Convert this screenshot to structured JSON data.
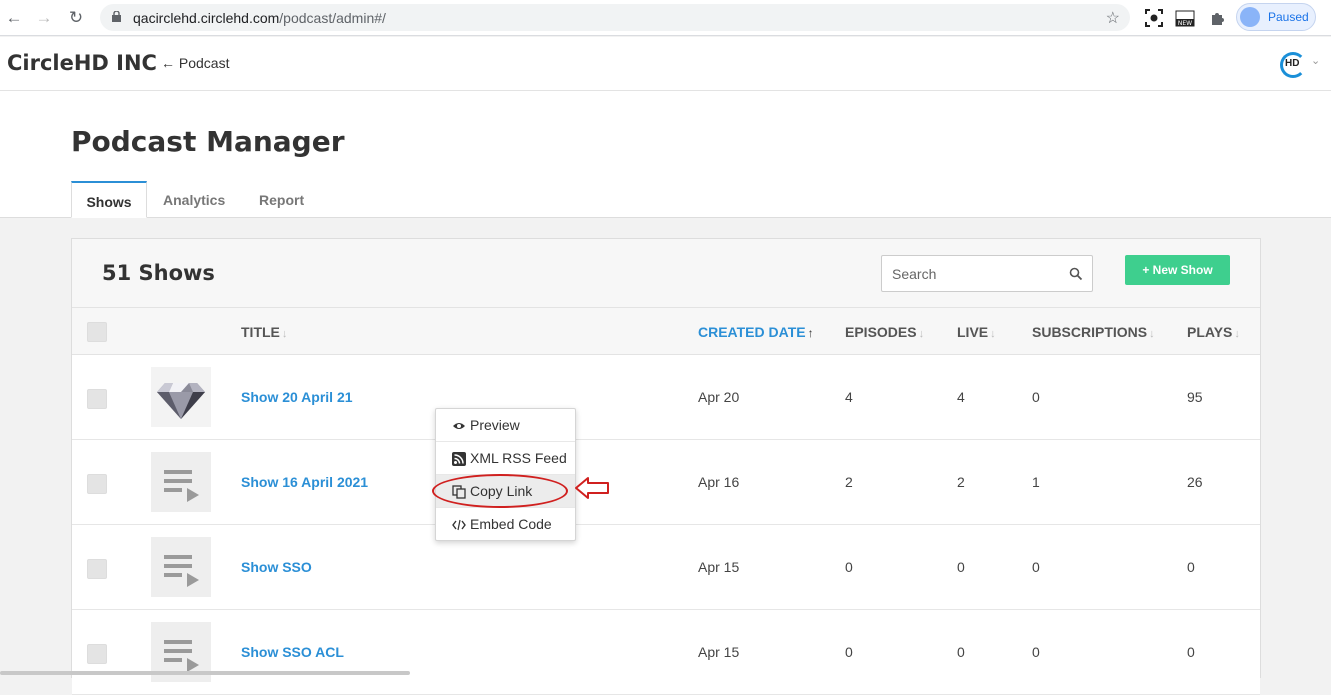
{
  "browser": {
    "url_host": "qacirclehd.circlehd.com",
    "url_path": "/podcast/admin#/",
    "profile_label": "Paused"
  },
  "app": {
    "brand": "CircleHD INC",
    "back_label": "Podcast",
    "logo_text": "HD"
  },
  "page": {
    "title": "Podcast Manager",
    "tabs": [
      {
        "label": "Shows",
        "active": true
      },
      {
        "label": "Analytics",
        "active": false
      },
      {
        "label": "Report",
        "active": false
      }
    ]
  },
  "shows": {
    "count_label": "51 Shows",
    "search_placeholder": "Search",
    "new_show_label": "+ New Show",
    "columns": {
      "title": "TITLE",
      "created": "CREATED DATE",
      "episodes": "EPISODES",
      "live": "LIVE",
      "subscriptions": "SUBSCRIPTIONS",
      "plays": "PLAYS"
    },
    "rows": [
      {
        "title": "Show 20 April 21",
        "created": "Apr 20",
        "episodes": "4",
        "live": "4",
        "subscriptions": "0",
        "plays": "95",
        "thumb": "diamond-icon"
      },
      {
        "title": "Show 16 April 2021",
        "created": "Apr 16",
        "episodes": "2",
        "live": "2",
        "subscriptions": "1",
        "plays": "26",
        "thumb": "playlist-icon"
      },
      {
        "title": "Show SSO",
        "created": "Apr 15",
        "episodes": "0",
        "live": "0",
        "subscriptions": "0",
        "plays": "0",
        "thumb": "playlist-icon"
      },
      {
        "title": "Show SSO ACL",
        "created": "Apr 15",
        "episodes": "0",
        "live": "0",
        "subscriptions": "0",
        "plays": "0",
        "thumb": "playlist-icon"
      }
    ]
  },
  "context_menu": {
    "items": [
      {
        "label": "Preview",
        "icon": "eye-icon"
      },
      {
        "label": "XML RSS Feed",
        "icon": "rss-icon"
      },
      {
        "label": "Copy Link",
        "icon": "copy-icon",
        "highlighted": true
      },
      {
        "label": "Embed Code",
        "icon": "code-icon"
      }
    ]
  },
  "colors": {
    "accent": "#2b8fd6",
    "new_button": "#3ecf8e",
    "annotation": "#d0201f"
  }
}
